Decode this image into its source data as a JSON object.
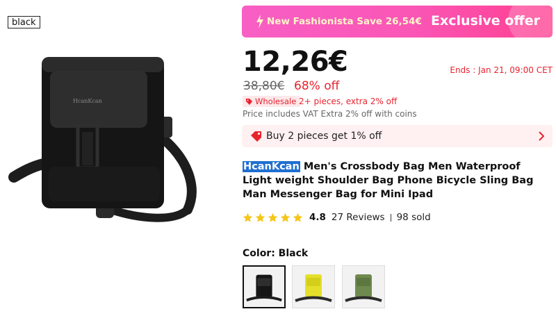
{
  "variant_tag": "black",
  "promo": {
    "text": "New Fashionista Save 26,54€",
    "offer": "Exclusive offer"
  },
  "price": {
    "current": "12,26€",
    "original": "38,80€",
    "discount": "68% off",
    "ends": "Ends :  Jan 21, 09:00 CET"
  },
  "wholesale": {
    "badge": "Wholesale",
    "note": "2+ pieces, extra 2% off"
  },
  "vat_note": "Price includes VAT Extra 2% off with coins",
  "bundle": {
    "text": "Buy 2 pieces get 1% off"
  },
  "product": {
    "brand": "HcanKcan",
    "title": " Men's Crossbody Bag Men Waterproof Light weight Shoulder Bag Phone Bicycle Sling Bag Man Messenger Bag for Mini Ipad"
  },
  "rating": {
    "value": "4.8",
    "stars": 5,
    "reviews": "27 Reviews",
    "sold": "98 sold"
  },
  "color": {
    "label": "Color: Black",
    "options": [
      "black",
      "yellow",
      "green"
    ],
    "selected": "black"
  },
  "colors": {
    "accent_red": "#e8232d",
    "promo_pink": "#f85fc4",
    "star_yellow": "#f5c518",
    "brand_highlight": "#1f6fd1"
  }
}
